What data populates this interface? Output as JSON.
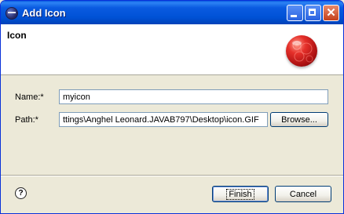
{
  "window": {
    "title": "Add Icon",
    "minimize_icon": "minimize-icon",
    "maximize_icon": "maximize-icon",
    "close_icon": "close-icon"
  },
  "header": {
    "title": "Icon",
    "banner_icon": "red-ball-icon"
  },
  "form": {
    "name_label": "Name:*",
    "name_value": "myicon",
    "path_label": "Path:*",
    "path_value": "ttings\\Anghel Leonard.JAVAB797\\Desktop\\icon.GIF",
    "browse_label": "Browse..."
  },
  "footer": {
    "help_icon": "help-icon",
    "finish_label": "Finish",
    "cancel_label": "Cancel"
  },
  "colors": {
    "titlebar": "#0a5ae0",
    "dialog_bg": "#ece9d8",
    "button_border": "#003c74"
  }
}
